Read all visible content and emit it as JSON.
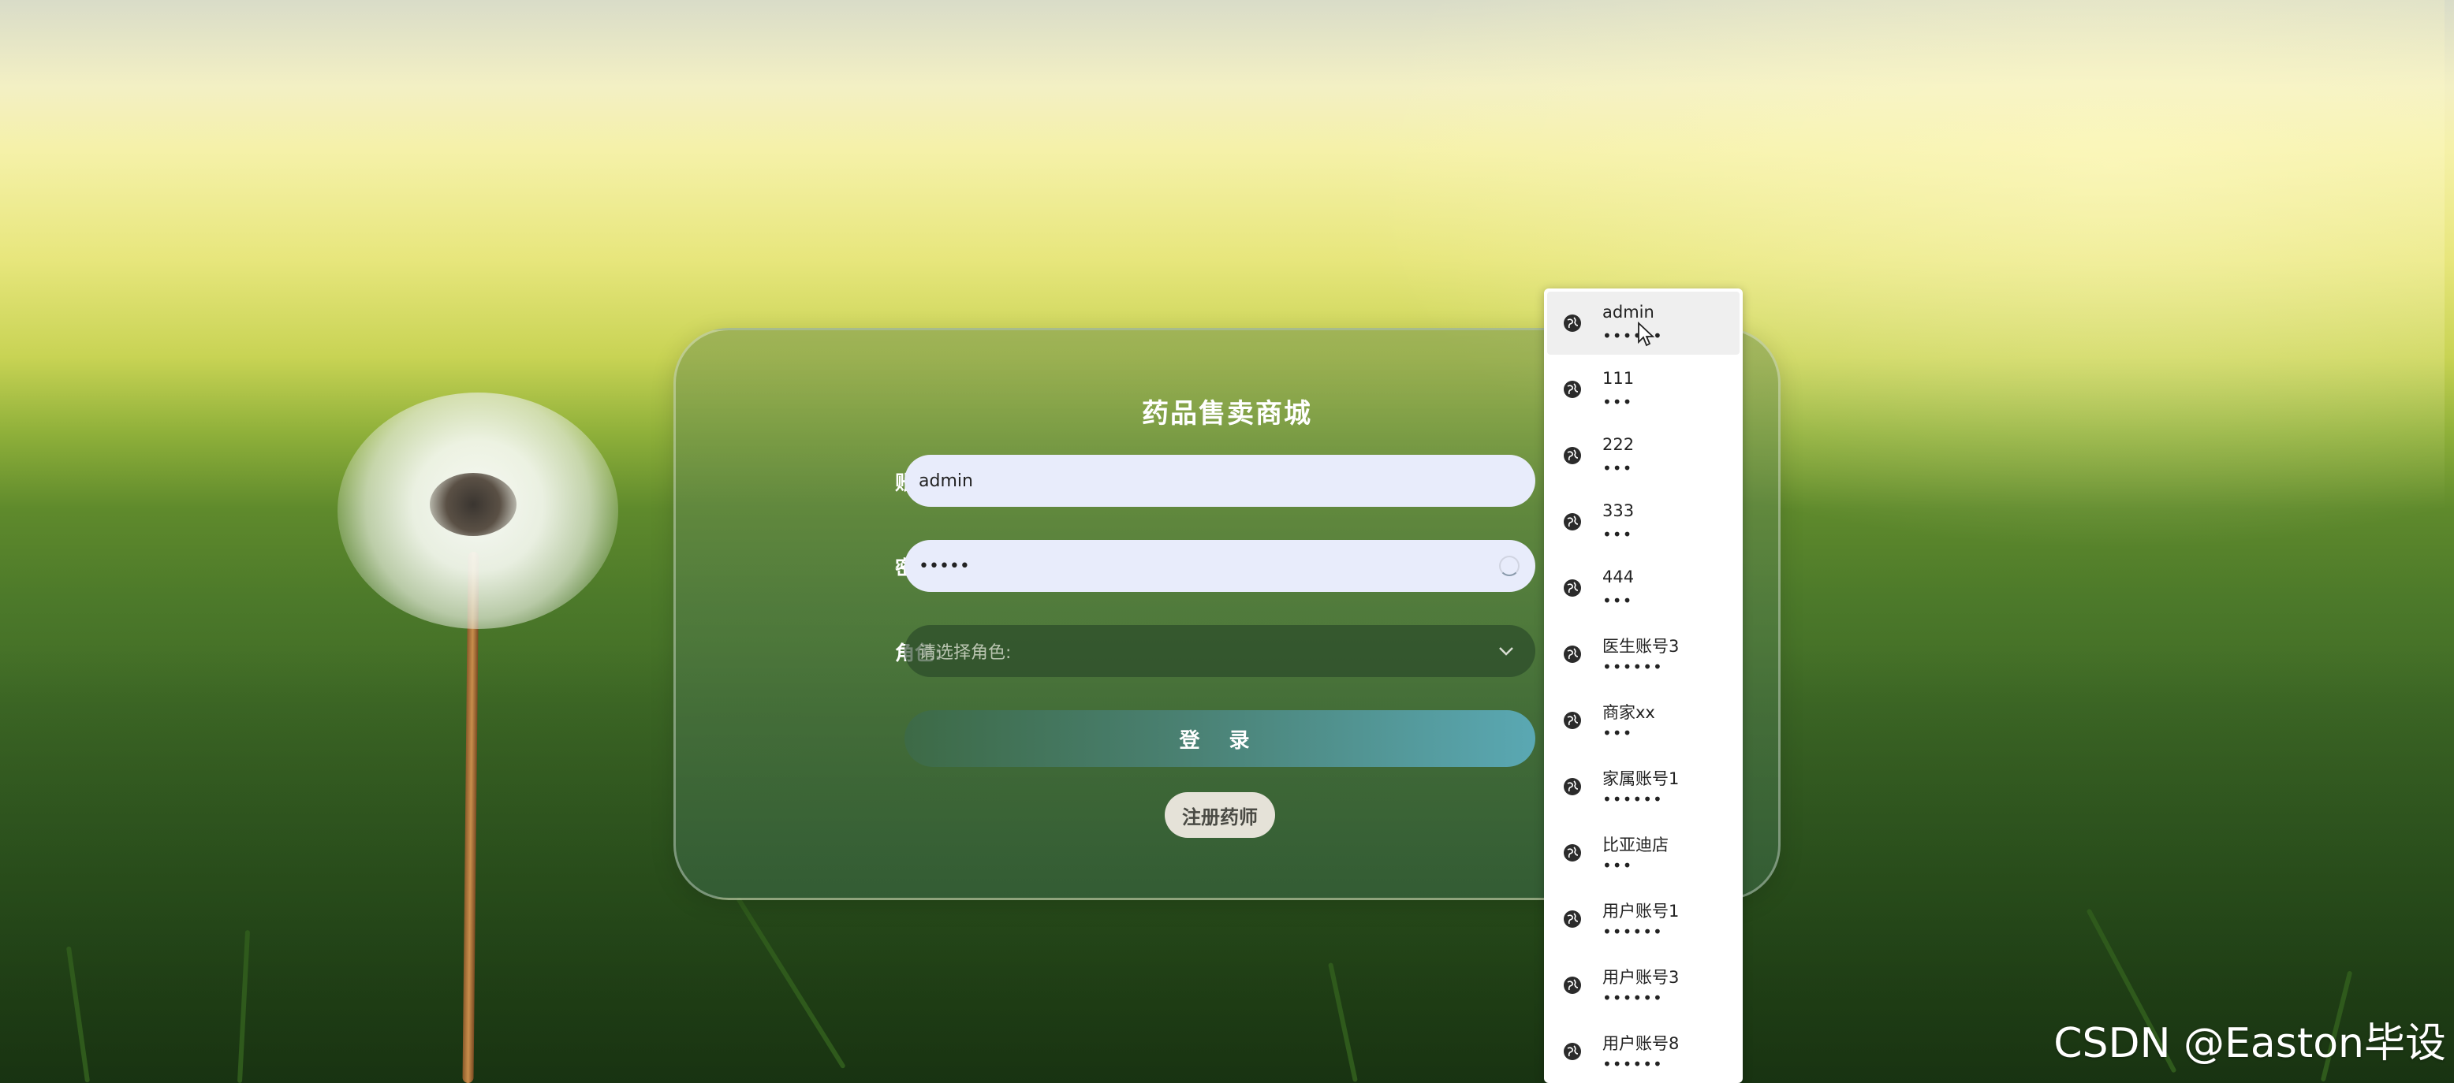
{
  "login": {
    "title": "药品售卖商城",
    "account_label": "账号:",
    "account_value": "admin",
    "password_label": "密码:",
    "password_value": "•••••",
    "role_label": "角色:",
    "role_placeholder": "请选择角色:",
    "login_button": "登 录",
    "register_button": "注册药师"
  },
  "autocomplete": {
    "items": [
      {
        "user": "admin",
        "pass": "••••••"
      },
      {
        "user": "111",
        "pass": "•••"
      },
      {
        "user": "222",
        "pass": "•••"
      },
      {
        "user": "333",
        "pass": "•••"
      },
      {
        "user": "444",
        "pass": "•••"
      },
      {
        "user": "医生账号3",
        "pass": "••••••"
      },
      {
        "user": "商家xx",
        "pass": "•••"
      },
      {
        "user": "家属账号1",
        "pass": "••••••"
      },
      {
        "user": "比亚迪店",
        "pass": "•••"
      },
      {
        "user": "用户账号1",
        "pass": "••••••"
      },
      {
        "user": "用户账号3",
        "pass": "••••••"
      },
      {
        "user": "用户账号8",
        "pass": "••••••"
      }
    ]
  },
  "watermark": "CSDN @Easton毕设"
}
